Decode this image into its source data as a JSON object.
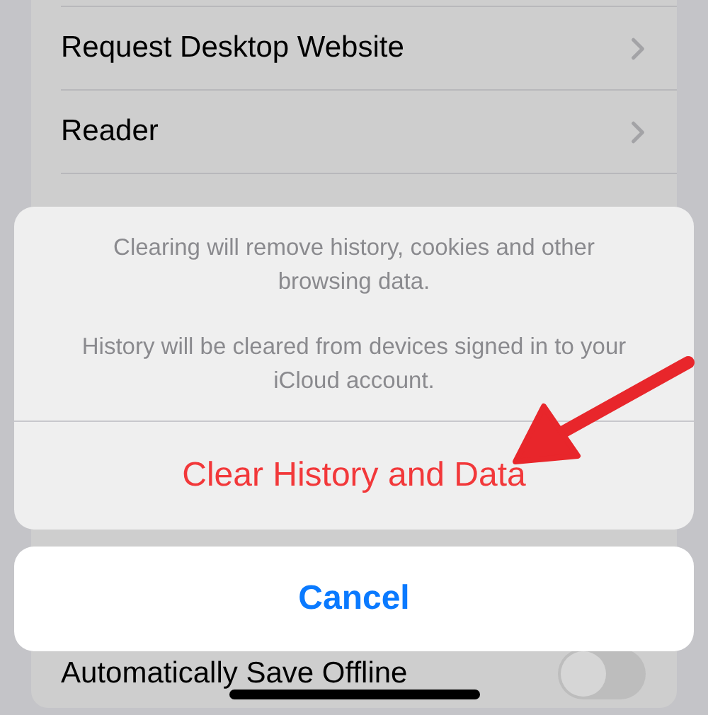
{
  "settings_rows": [
    {
      "label": "Request Desktop Website",
      "kind": "link"
    },
    {
      "label": "Reader",
      "kind": "link"
    },
    {
      "label": "",
      "kind": "hidden"
    },
    {
      "label": "Automatically Save Offline",
      "kind": "toggle",
      "on": false
    }
  ],
  "action_sheet": {
    "messages": [
      "Clearing will remove history, cookies and other browsing data.",
      "History will be cleared from devices signed in to your iCloud account."
    ],
    "destructive_action": "Clear History and Data",
    "cancel": "Cancel"
  }
}
